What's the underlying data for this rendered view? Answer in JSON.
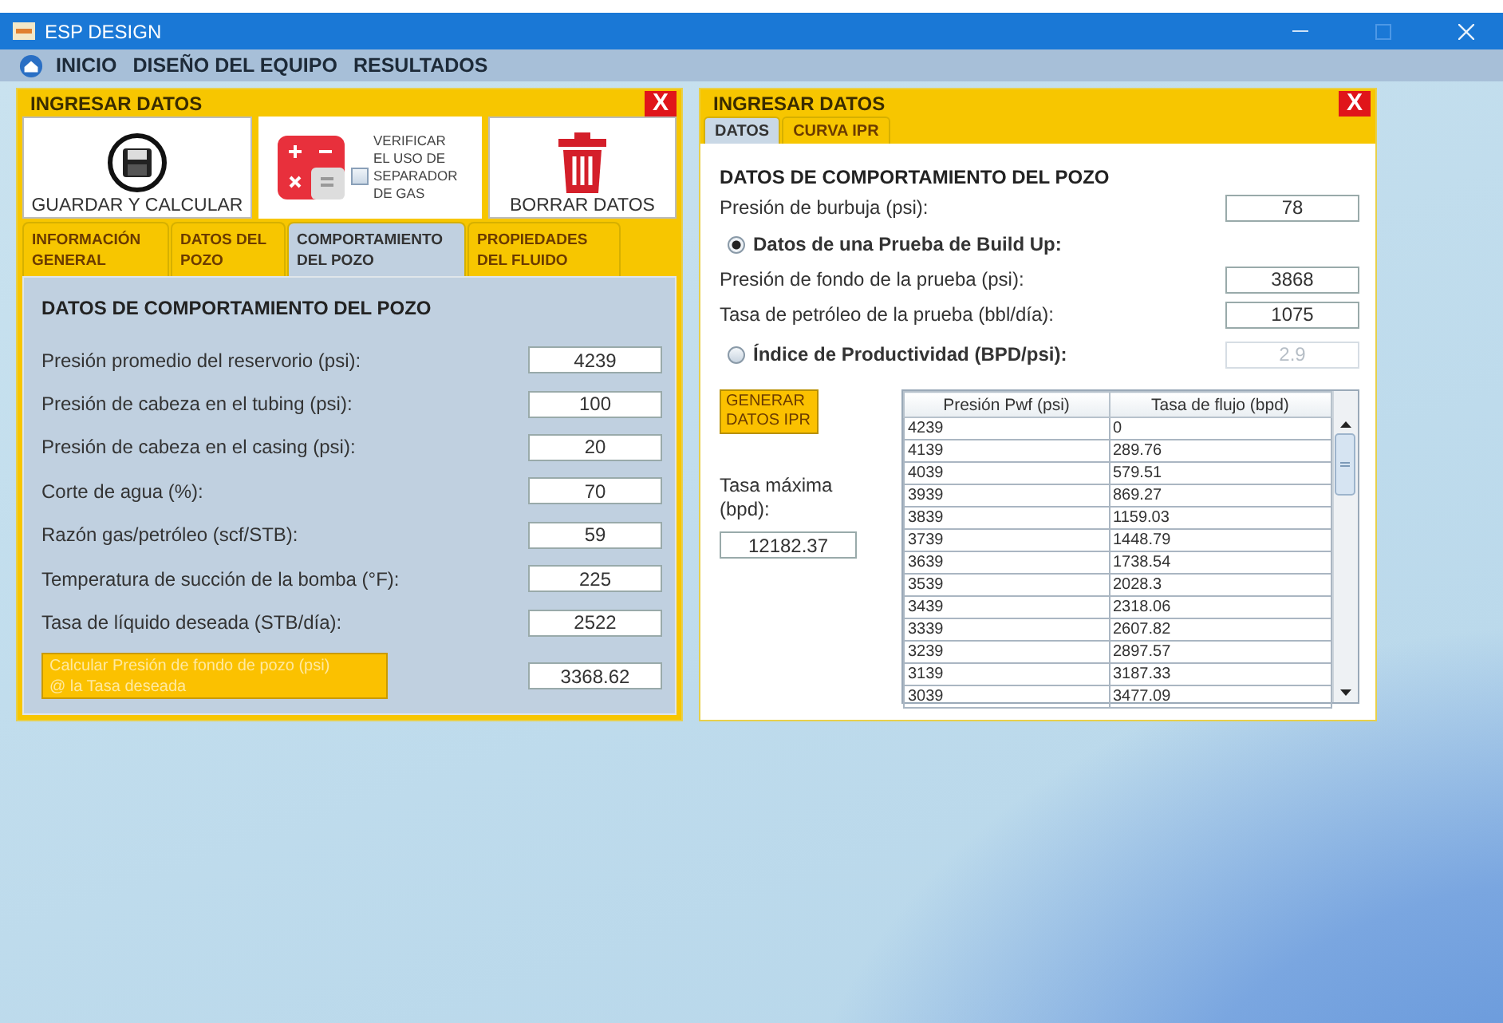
{
  "window": {
    "title": "ESP DESIGN"
  },
  "menu": [
    {
      "label": "INICIO"
    },
    {
      "label": "DISEÑO DEL EQUIPO"
    },
    {
      "label": "RESULTADOS"
    }
  ],
  "left_panel": {
    "title": "INGRESAR DATOS",
    "close": "X",
    "toolbar": {
      "save": "GUARDAR Y CALCULAR",
      "separator_check": {
        "label": "VERIFICAR\nEL USO DE\nSEPARADOR\nDE GAS",
        "checked": false
      },
      "delete": "BORRAR DATOS"
    },
    "tabs": [
      {
        "label": "INFORMACIÓN\nGENERAL",
        "selected": false
      },
      {
        "label": "DATOS DEL\nPOZO",
        "selected": false
      },
      {
        "label": "COMPORTAMIENTO\nDEL POZO",
        "selected": true
      },
      {
        "label": "PROPIEDADES\nDEL FLUIDO",
        "selected": false
      }
    ],
    "heading": "DATOS DE COMPORTAMIENTO DEL POZO",
    "fields": [
      {
        "label": "Presión promedio del reservorio (psi):",
        "value": "4239"
      },
      {
        "label": "Presión de cabeza en el tubing (psi):",
        "value": "100"
      },
      {
        "label": "Presión de cabeza en el casing (psi):",
        "value": "20"
      },
      {
        "label": "Corte de agua (%):",
        "value": "70"
      },
      {
        "label": "Razón gas/petróleo (scf/STB):",
        "value": "59"
      },
      {
        "label": "Temperatura de succión de la bomba (°F):",
        "value": "225"
      },
      {
        "label": "Tasa de líquido deseada (STB/día):",
        "value": "2522"
      }
    ],
    "calc_button": "Calcular Presión de fondo de pozo (psi)\n@ la Tasa deseada",
    "calc_value": "3368.62"
  },
  "right_panel": {
    "title": "INGRESAR DATOS",
    "close": "X",
    "tabs": [
      {
        "label": "DATOS",
        "selected": true
      },
      {
        "label": "CURVA IPR",
        "selected": false
      }
    ],
    "heading": "DATOS DE COMPORTAMIENTO DEL POZO",
    "bubble": {
      "label": "Presión de burbuja (psi):",
      "value": "78"
    },
    "methods": [
      {
        "label": "Datos de una Prueba de Build Up:",
        "selected": true,
        "fields": [
          {
            "label": "Presión de fondo de la prueba (psi):",
            "value": "3868"
          },
          {
            "label": "Tasa de petróleo de la prueba (bbl/día):",
            "value": "1075"
          }
        ]
      },
      {
        "label": "Índice de Productividad (BPD/psi):",
        "selected": false,
        "value": "2.9"
      }
    ],
    "generate_button": "GENERAR\nDATOS IPR",
    "max_rate": {
      "label": "Tasa máxima\n(bpd):",
      "value": "12182.37"
    },
    "table": {
      "columns": [
        "Presión Pwf (psi)",
        "Tasa de flujo (bpd)"
      ],
      "rows": [
        [
          "4239",
          "0"
        ],
        [
          "4139",
          "289.76"
        ],
        [
          "4039",
          "579.51"
        ],
        [
          "3939",
          "869.27"
        ],
        [
          "3839",
          "1159.03"
        ],
        [
          "3739",
          "1448.79"
        ],
        [
          "3639",
          "1738.54"
        ],
        [
          "3539",
          "2028.3"
        ],
        [
          "3439",
          "2318.06"
        ],
        [
          "3339",
          "2607.82"
        ],
        [
          "3239",
          "2897.57"
        ],
        [
          "3139",
          "3187.33"
        ],
        [
          "3039",
          "3477.09"
        ]
      ]
    }
  }
}
